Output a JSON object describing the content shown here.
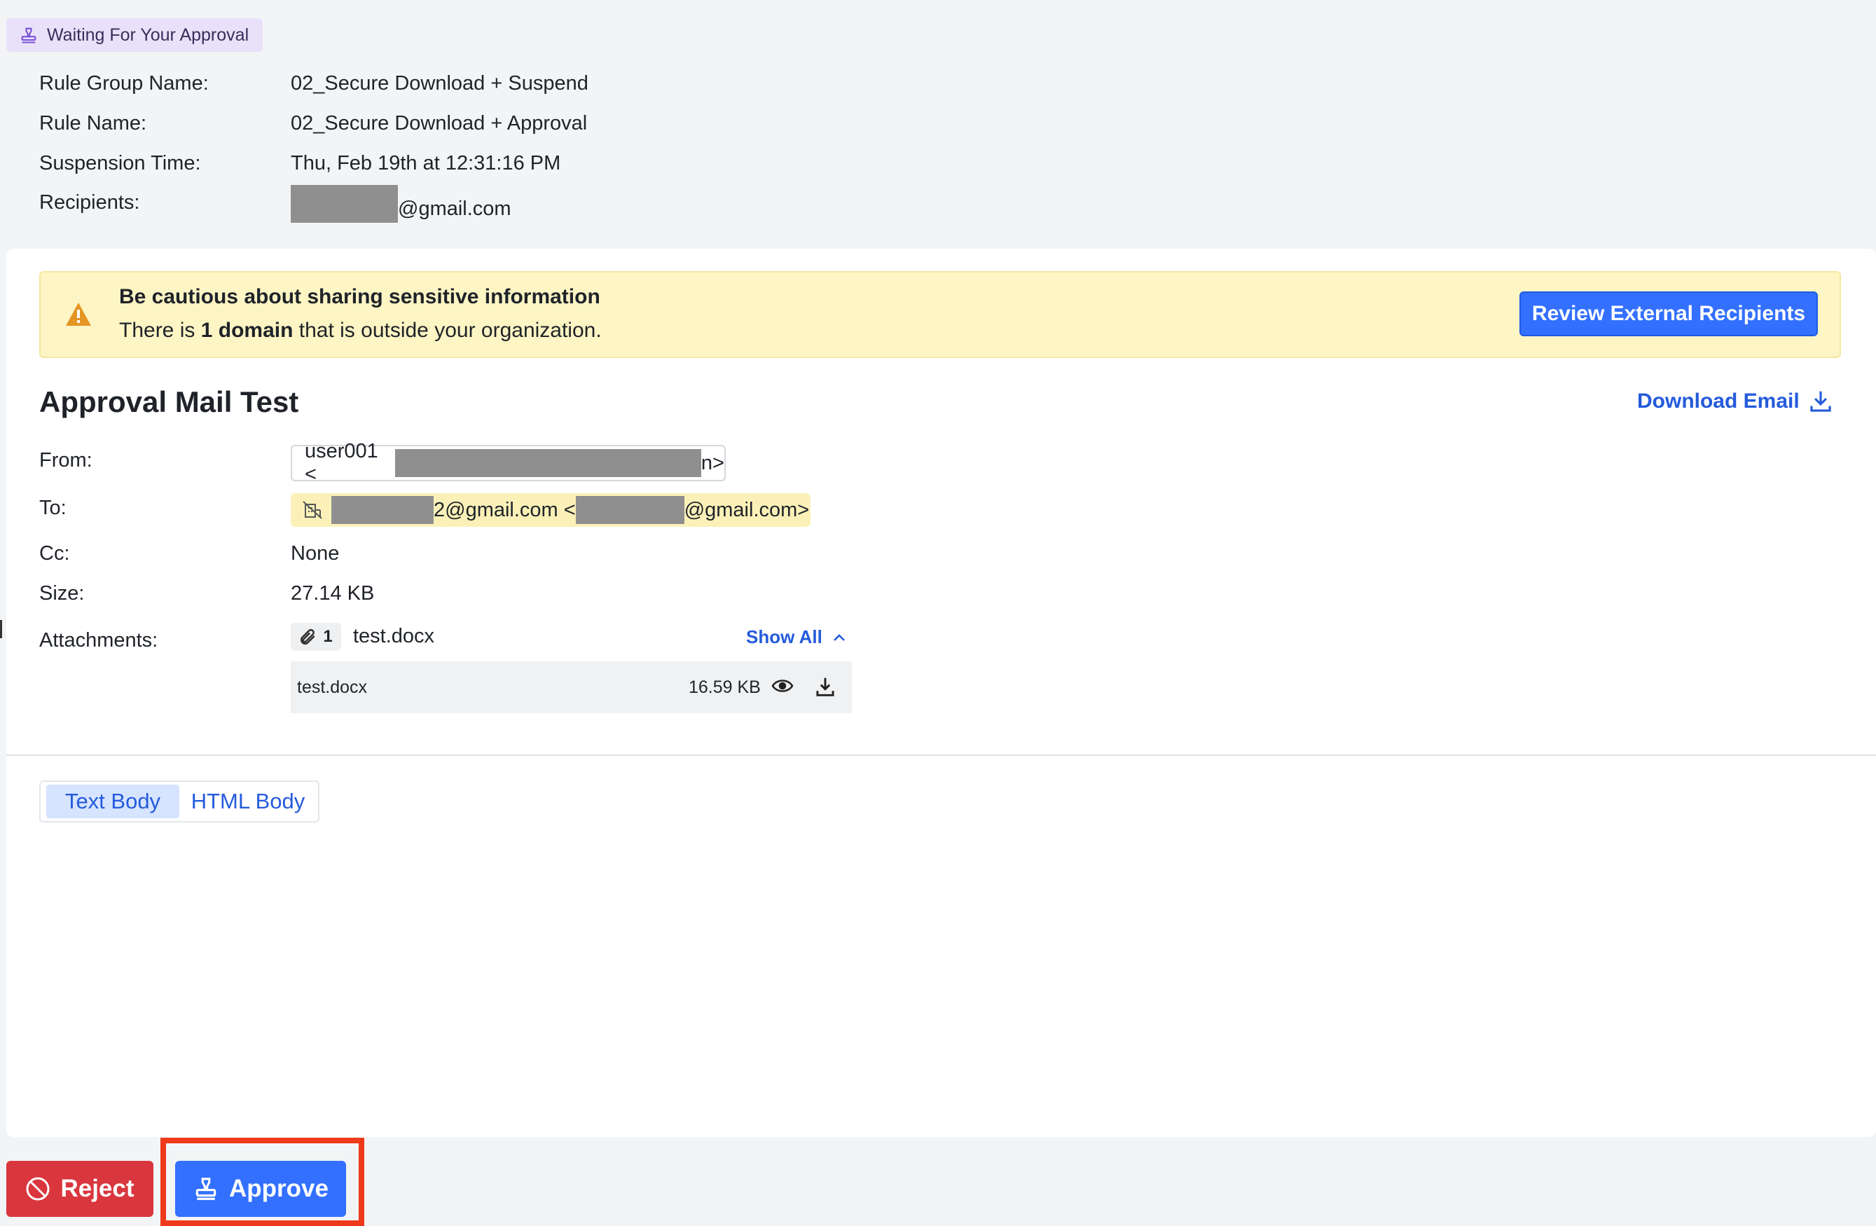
{
  "status_badge": {
    "label": "Waiting For Your Approval",
    "icon": "approval-stamp-icon"
  },
  "meta": [
    {
      "label": "Rule Group Name:",
      "value": "02_Secure Download + Suspend"
    },
    {
      "label": "Rule Name:",
      "value": "02_Secure Download + Approval"
    },
    {
      "label": "Suspension Time:",
      "value": "Thu, Feb 19th at 12:31:16 PM"
    },
    {
      "label": "Recipients:",
      "value_suffix": "@gmail.com"
    }
  ],
  "warning": {
    "title": "Be cautious about sharing sensitive information",
    "text_before": "There is ",
    "text_bold": "1 domain",
    "text_after": " that is outside your organization.",
    "button_label": "Review External Recipients",
    "icon": "warning-triangle-icon"
  },
  "email": {
    "subject": "Approval Mail Test",
    "download_label": "Download Email",
    "from_label": "From:",
    "from_prefix": "user001 <",
    "from_suffix": "n>",
    "to_label": "To:",
    "to_part1": "2@gmail.com <",
    "to_part2": "@gmail.com>",
    "cc_label": "Cc:",
    "cc_value": "None",
    "size_label": "Size:",
    "size_value": "27.14 KB",
    "attachments_label": "Attachments:",
    "attachment_count": "1",
    "attachment_name": "test.docx",
    "show_all_label": "Show All",
    "attachments": [
      {
        "name": "test.docx",
        "size": "16.59 KB"
      }
    ]
  },
  "body_tabs": [
    {
      "label": "Text Body",
      "active": true
    },
    {
      "label": "HTML Body",
      "active": false
    }
  ],
  "actions": {
    "reject_label": "Reject",
    "approve_label": "Approve"
  },
  "colors": {
    "primary": "#3370ff",
    "danger": "#d9363e",
    "warning_bg": "#fdf5c4",
    "highlight": "#ee3a1b"
  }
}
